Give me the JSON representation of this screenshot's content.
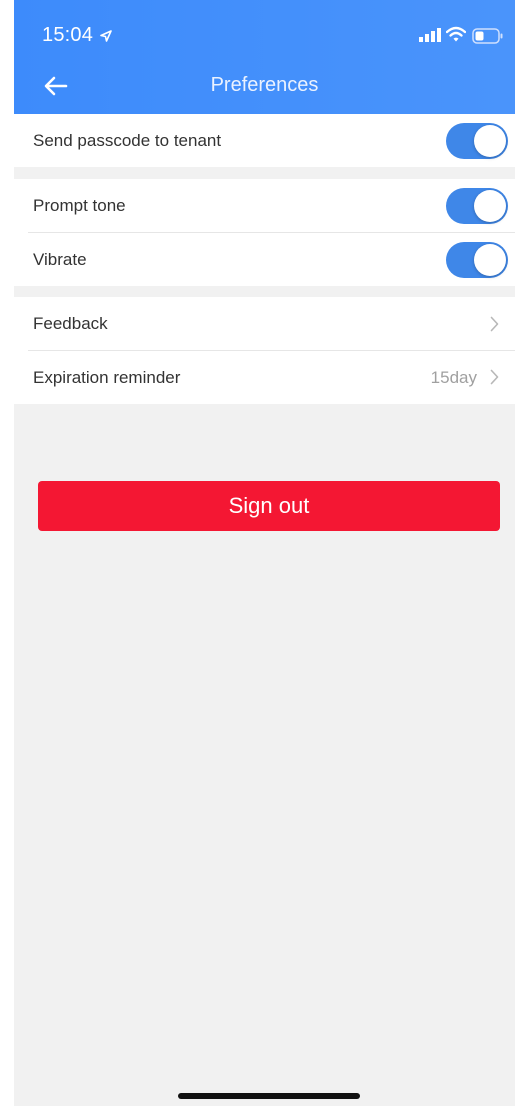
{
  "status_bar": {
    "time": "15:04",
    "icons": [
      "location-arrow-icon",
      "signal-icon",
      "wifi-icon",
      "battery-icon"
    ]
  },
  "header": {
    "title": "Preferences",
    "back_icon": "arrow-left-icon"
  },
  "settings": {
    "send_passcode": {
      "label": "Send passcode to tenant",
      "enabled": true
    },
    "prompt_tone": {
      "label": "Prompt tone",
      "enabled": true
    },
    "vibrate": {
      "label": "Vibrate",
      "enabled": true
    },
    "feedback": {
      "label": "Feedback"
    },
    "expiration_reminder": {
      "label": "Expiration reminder",
      "value": "15day"
    }
  },
  "sign_out": {
    "label": "Sign out"
  },
  "colors": {
    "header": "#4a94fb",
    "toggle_on": "#3f87e8",
    "sign_out": "#f41733",
    "background": "#f1f1f1"
  }
}
